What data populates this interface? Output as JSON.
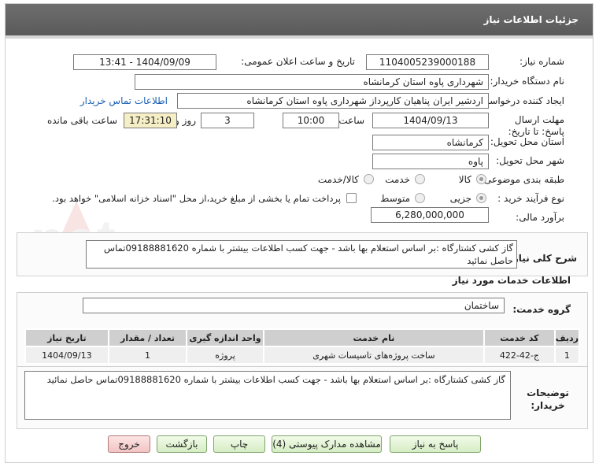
{
  "header": {
    "title": "جزئیات اطلاعات نیاز"
  },
  "fields": {
    "need_number_label": "شماره نیاز:",
    "need_number": "1104005239000188",
    "announce_label": "تاریخ و ساعت اعلان عمومی:",
    "announce_value": "1404/09/09 - 13:41",
    "buyer_org_label": "نام دستگاه خریدار:",
    "buyer_org": "شهرداری پاوه استان کرمانشاه",
    "creator_label": "ایجاد کننده درخواست:",
    "creator": "اردشیر ایران پناهیان کارپرداز شهرداری پاوه استان کرمانشاه",
    "contact_link": "اطلاعات تماس خریدار",
    "deadline_label": "مهلت ارسال پاسخ: تا تاریخ:",
    "deadline_date": "1404/09/13",
    "time_label": "ساعت",
    "deadline_time": "10:00",
    "days_value": "3",
    "days_label": "روز و",
    "remaining_time": "17:31:10",
    "remaining_label": "ساعت باقی مانده",
    "province_label": "استان محل تحویل:",
    "province": "کرمانشاه",
    "city_label": "شهر محل تحویل:",
    "city": "پاوه",
    "category_label": "طبقه بندی موضوعی:",
    "category_options": [
      "کالا",
      "خدمت",
      "کالا/خدمت"
    ],
    "purchase_label": "نوع فرآیند خرید :",
    "purchase_options": [
      "جزیی",
      "متوسط"
    ],
    "payment_note": "پرداخت تمام یا بخشی از مبلغ خرید،از محل \"اسناد خزانه اسلامی\" خواهد بود.",
    "estimate_label": "برآورد مالی:",
    "estimate": "6,280,000,000"
  },
  "description": {
    "label": "شرح کلی نیاز:",
    "text": "گاز کشی کشتارگاه :بر اساس استعلام بها باشد - جهت کسب اطلاعات بیشتر با شماره 09188881620تماس حاصل نمائید"
  },
  "services": {
    "section_title": "اطلاعات خدمات مورد نیاز",
    "group_label": "گروه خدمت:",
    "group_value": "ساختمان",
    "columns": [
      "ردیف",
      "کد خدمت",
      "نام خدمت",
      "واحد اندازه گیری",
      "تعداد / مقدار",
      "تاریخ نیاز"
    ],
    "rows": [
      [
        "1",
        "ج-42-422",
        "ساخت پروژه‌های تاسیسات شهری",
        "پروژه",
        "1",
        "1404/09/13"
      ]
    ]
  },
  "buyer_notes": {
    "label": "توضیحات خریدار:",
    "text": "گاز کشی کشتارگاه :بر اساس استعلام بها باشد - جهت کسب اطلاعات بیشتر با شماره 09188881620تماس حاصل نمائید"
  },
  "buttons": {
    "reply": "پاسخ به نیاز",
    "attachments": "مشاهده مدارک پیوستی (4)",
    "print": "چاپ",
    "back": "بازگشت",
    "exit": "خروج"
  },
  "watermark": {
    "text": "AriaTender.net"
  }
}
